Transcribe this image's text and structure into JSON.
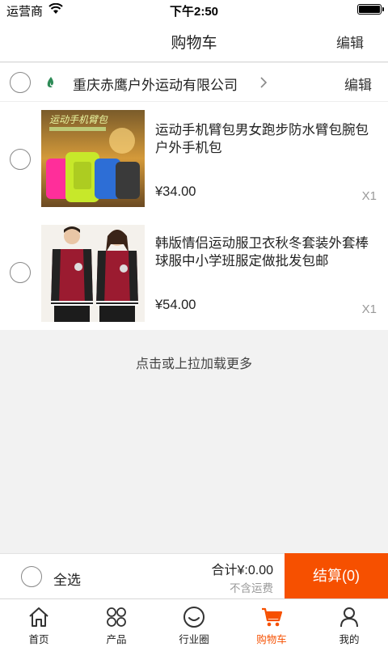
{
  "status_bar": {
    "carrier": "运营商",
    "time": "下午2:50"
  },
  "nav": {
    "title": "购物车",
    "edit_label": "编辑"
  },
  "shop": {
    "name": "重庆赤鹰户外运动有限公司",
    "edit_label": "编辑"
  },
  "items": [
    {
      "title": "运动手机臂包男女跑步防水臂包腕包户外手机包",
      "price": "¥34.00",
      "qty": "X1",
      "image_caption": "运动手机臂包"
    },
    {
      "title": "韩版情侣运动服卫衣秋冬套装外套棒球服中小学班服定做批发包邮",
      "price": "¥54.00",
      "qty": "X1"
    }
  ],
  "load_more": "点击或上拉加载更多",
  "bottom": {
    "select_all": "全选",
    "total": "合计¥:0.00",
    "shipping": "不含运费",
    "checkout": "结算(0)"
  },
  "tabs": [
    {
      "label": "首页",
      "icon": "home-icon"
    },
    {
      "label": "产品",
      "icon": "grid-icon"
    },
    {
      "label": "行业圈",
      "icon": "smile-icon"
    },
    {
      "label": "购物车",
      "icon": "cart-icon",
      "active": true
    },
    {
      "label": "我的",
      "icon": "user-icon"
    }
  ],
  "colors": {
    "accent": "#f65000"
  }
}
